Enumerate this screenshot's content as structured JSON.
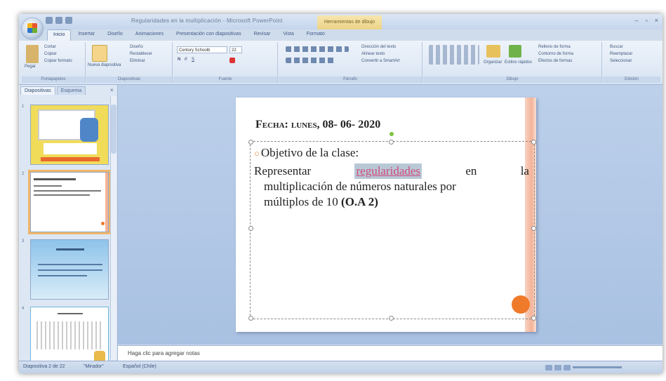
{
  "window": {
    "title": "Regularidades en la multiplicación - Microsoft PowerPoint",
    "contextual_tab": "Herramientas de dibujo",
    "controls": [
      "–",
      "▫",
      "×"
    ]
  },
  "ribbon": {
    "tabs": [
      "Inicio",
      "Insertar",
      "Diseño",
      "Animaciones",
      "Presentación con diapositivas",
      "Revisar",
      "Vista",
      "Formato"
    ],
    "active_tab": "Inicio",
    "groups": {
      "clipboard": {
        "label": "Portapapeles",
        "items": [
          "Cortar",
          "Copiar",
          "Copiar formato"
        ],
        "paste": "Pegar"
      },
      "slides": {
        "label": "Diapositivas",
        "items": [
          "Diseño",
          "Restablecer",
          "Eliminar"
        ],
        "new_slide": "Nueva diapositiva"
      },
      "font": {
        "label": "Fuente",
        "font_name": "Century Schoolb",
        "font_size": "22"
      },
      "paragraph": {
        "label": "Párrafo",
        "items": [
          "Dirección del texto",
          "Alinear texto",
          "Convertir a SmartArt"
        ]
      },
      "drawing": {
        "label": "Dibujo",
        "items": [
          "Relleno de forma",
          "Contorno de forma",
          "Efectos de formas"
        ],
        "arrange": "Organizar",
        "styles": "Estilos rápidos"
      },
      "editing": {
        "label": "Edición",
        "items": [
          "Buscar",
          "Reemplazar",
          "Seleccionar"
        ]
      }
    }
  },
  "panel": {
    "tabs": [
      "Diapositivas",
      "Esquema"
    ],
    "close": "×",
    "thumbs": [
      {
        "num": "1",
        "kind": "title"
      },
      {
        "num": "2",
        "kind": "objective"
      },
      {
        "num": "3",
        "kind": "text"
      },
      {
        "num": "4",
        "kind": "multiplication"
      }
    ]
  },
  "slide": {
    "title": "Fecha: lunes, 08- 06- 2020",
    "bullet": "Objetivo de la clase:",
    "body_line1": [
      "Representar",
      "regularidades",
      "en",
      "la"
    ],
    "body_line2": "multiplicación de números naturales por",
    "body_line3": "múltiplos de 10",
    "body_bold": "(O.A 2)"
  },
  "notes": {
    "placeholder": "Haga clic para agregar notas"
  },
  "status": {
    "slide_counter": "Diapositiva 2 de 22",
    "theme": "\"Mirador\"",
    "language": "Español (Chile)"
  },
  "colors": {
    "accent_circle": "#ef7a2a",
    "highlight": "#d24a7a",
    "slide_bar": "#f3b398"
  }
}
